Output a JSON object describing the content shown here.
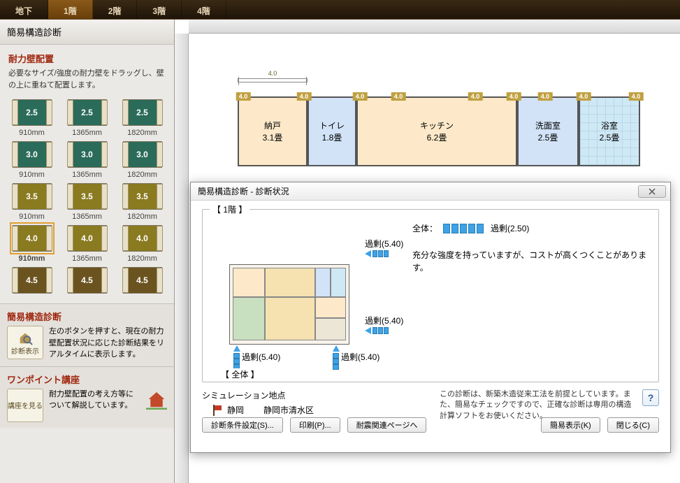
{
  "tabs": {
    "basement": "地下",
    "f1": "1階",
    "f2": "2階",
    "f3": "3階",
    "f4": "4階",
    "active": "f1"
  },
  "sidebar": {
    "title": "簡易構造診断",
    "section1_header": "耐力壁配置",
    "section1_help": "必要なサイズ/強度の耐力壁をドラッグし、壁の上に重ねて配置します。",
    "wall_palette": [
      {
        "val": "2.5",
        "width": "910mm",
        "color": "green"
      },
      {
        "val": "2.5",
        "width": "1365mm",
        "color": "green"
      },
      {
        "val": "2.5",
        "width": "1820mm",
        "color": "green"
      },
      {
        "val": "3.0",
        "width": "910mm",
        "color": "green"
      },
      {
        "val": "3.0",
        "width": "1365mm",
        "color": "green"
      },
      {
        "val": "3.0",
        "width": "1820mm",
        "color": "green"
      },
      {
        "val": "3.5",
        "width": "910mm",
        "color": "olive"
      },
      {
        "val": "3.5",
        "width": "1365mm",
        "color": "olive"
      },
      {
        "val": "3.5",
        "width": "1820mm",
        "color": "olive"
      },
      {
        "val": "4.0",
        "width": "910mm",
        "color": "olive",
        "selected": true
      },
      {
        "val": "4.0",
        "width": "1365mm",
        "color": "olive"
      },
      {
        "val": "4.0",
        "width": "1820mm",
        "color": "olive"
      },
      {
        "val": "4.5",
        "width": "",
        "color": "brown"
      },
      {
        "val": "4.5",
        "width": "",
        "color": "brown"
      },
      {
        "val": "4.5",
        "width": "",
        "color": "brown"
      }
    ],
    "diag_header": "簡易構造診断",
    "diag_btn": "診断表示",
    "diag_help": "左のボタンを押すと、現在の耐力壁配置状況に応じた診断結果をリアルタイムに表示します。",
    "tips_header": "ワンポイント講座",
    "tips_btn": "講座を見る",
    "tips_help": "耐力壁配置の考え方等について解説しています。"
  },
  "floorplan": {
    "dim_label": "4.0",
    "rooms": [
      {
        "key": "closet",
        "name": "納戸",
        "size": "3.1畳"
      },
      {
        "key": "toilet",
        "name": "トイレ",
        "size": "1.8畳"
      },
      {
        "key": "kitchen",
        "name": "キッチン",
        "size": "6.2畳"
      },
      {
        "key": "wash",
        "name": "洗面室",
        "size": "2.5畳"
      },
      {
        "key": "bath",
        "name": "浴室",
        "size": "2.5畳"
      }
    ]
  },
  "dialog": {
    "title": "簡易構造診断 - 診断状況",
    "fs_legend": "【 1階 】",
    "overall_label": "全体：",
    "overall_status": "過剰(2.50)",
    "message": "充分な強度を持っていますが、コストが高くつくことがあります。",
    "side_top": "過剰(5.40)",
    "side_right": "過剰(5.40)",
    "side_bottom1": "過剰(5.40)",
    "side_bottom2": "過剰(5.40)",
    "fs2_legend": "【 全体 】",
    "location_header": "シミュレーション地点",
    "location_pref": "静岡",
    "location_city": "静岡市清水区",
    "location_note": "この診断は、新築木造従来工法を前提としています。また、簡易なチェックですので、正確な診断は専用の構造計算ソフトをお使いください。",
    "buttons": {
      "settings": "診断条件設定(S)...",
      "print": "印刷(P)...",
      "seismic": "耐震関連ページへ",
      "simple": "簡易表示(K)",
      "close": "閉じる(C)"
    }
  }
}
